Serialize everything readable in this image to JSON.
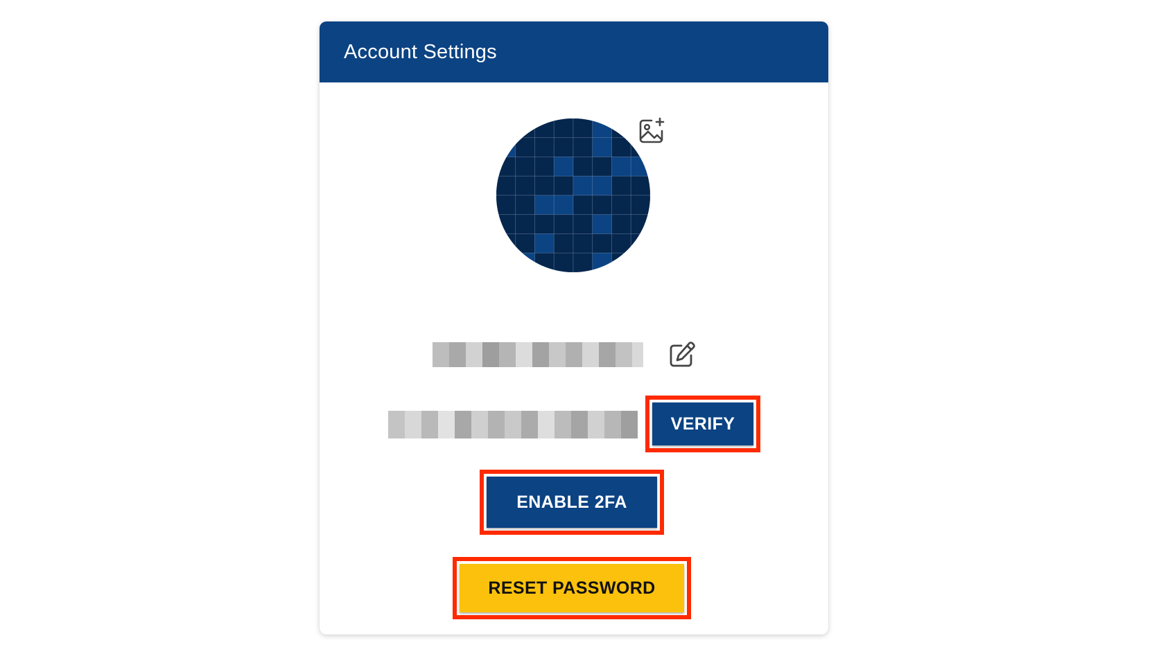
{
  "card": {
    "title": "Account Settings"
  },
  "avatar": {
    "icon": "pixel-identicon",
    "colors": {
      "dark": "#05264d",
      "light": "#0b4383"
    }
  },
  "profile": {
    "change_photo_icon": "image-plus-icon",
    "name_redacted": true,
    "edit_name_icon": "edit-square-icon",
    "email_redacted": true
  },
  "buttons": {
    "verify": "VERIFY",
    "enable_2fa": "ENABLE 2FA",
    "reset_password": "RESET PASSWORD"
  },
  "colors": {
    "header": "#0b4383",
    "primary_button": "#0b4383",
    "warning_button": "#fcc10c",
    "highlight_outline": "#ff2a00"
  }
}
